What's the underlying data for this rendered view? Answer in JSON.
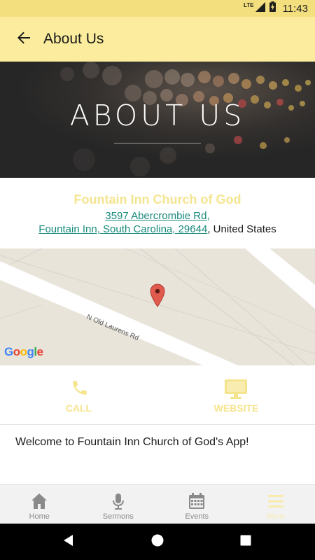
{
  "status_bar": {
    "network": "LTE",
    "time": "11:43"
  },
  "app_bar": {
    "title": "About Us",
    "back_icon": "arrow-back-icon"
  },
  "hero": {
    "title": "ABOUT US"
  },
  "church": {
    "name": "Fountain Inn Church of God",
    "address_line1": "3597 Abercrombie Rd,",
    "address_line2_link": "Fountain Inn, South Carolina, 29644",
    "address_country": ", United States"
  },
  "map": {
    "street_label": "N Old Laurens Rd",
    "provider": "Google",
    "marker_icon": "map-pin-icon"
  },
  "actions": {
    "call": {
      "label": "CALL",
      "icon": "phone-icon"
    },
    "website": {
      "label": "WEBSITE",
      "icon": "monitor-icon"
    }
  },
  "welcome_text": "Welcome to Fountain Inn Church of God's App!",
  "bottom_nav": {
    "items": [
      {
        "label": "Home",
        "icon": "home-icon"
      },
      {
        "label": "Sermons",
        "icon": "microphone-icon"
      },
      {
        "label": "Events",
        "icon": "calendar-icon"
      },
      {
        "label": "More",
        "icon": "menu-icon",
        "active": true
      }
    ]
  },
  "colors": {
    "status_bar": "#f3df7e",
    "app_bar": "#fbed9d",
    "accent": "#f5e48e",
    "link": "#178a7a"
  }
}
